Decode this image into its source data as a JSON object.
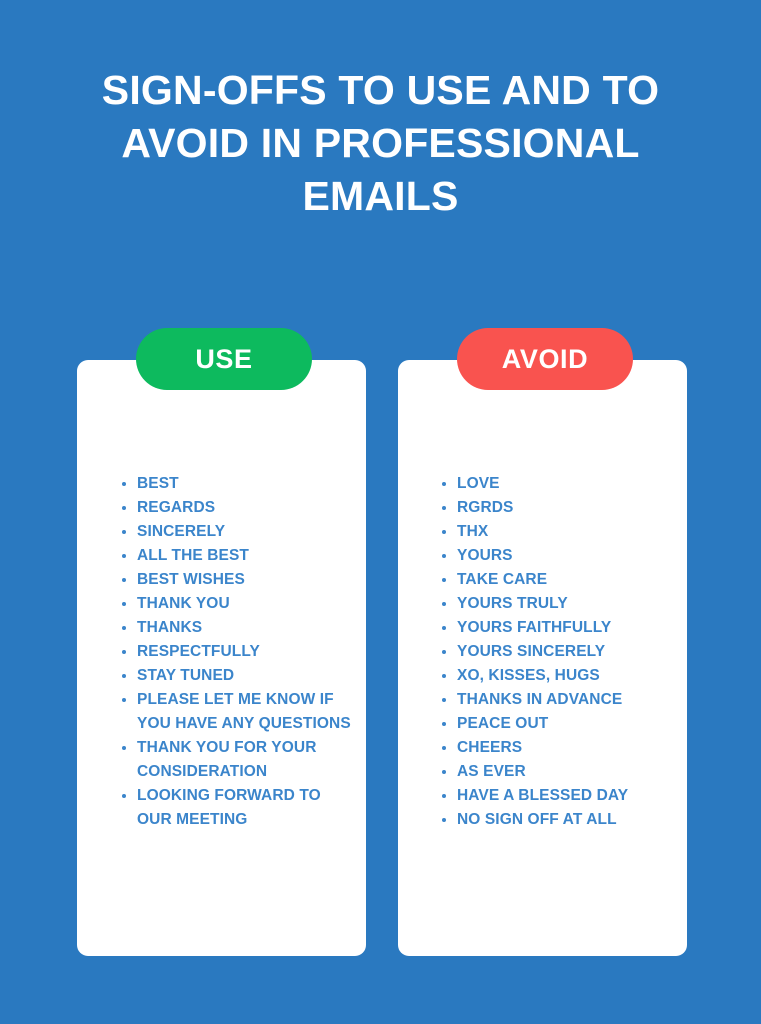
{
  "header": {
    "title": "SIGN-OFFS TO USE AND TO AVOID IN PROFESSIONAL EMAILS"
  },
  "colors": {
    "background": "#2a79c0",
    "card": "#ffffff",
    "use_badge": "#0dba5e",
    "avoid_badge": "#f9534f",
    "list_text": "#3b85cb",
    "title_text": "#ffffff"
  },
  "columns": [
    {
      "id": "use",
      "badge_label": "USE",
      "items": [
        "BEST",
        "REGARDS",
        "SINCERELY",
        "ALL THE BEST",
        "BEST WISHES",
        "THANK YOU",
        "THANKS",
        "RESPECTFULLY",
        "STAY TUNED",
        "PLEASE LET ME KNOW IF YOU HAVE ANY QUESTIONS",
        "THANK YOU FOR YOUR CONSIDERATION",
        "LOOKING FORWARD TO OUR MEETING"
      ]
    },
    {
      "id": "avoid",
      "badge_label": "AVOID",
      "items": [
        "LOVE",
        "RGRDS",
        "THX",
        "YOURS",
        "TAKE CARE",
        "YOURS TRULY",
        "YOURS FAITHFULLY",
        "YOURS SINCERELY",
        "XO, KISSES, HUGS",
        "THANKS IN ADVANCE",
        "PEACE OUT",
        "CHEERS",
        "AS EVER",
        "HAVE A BLESSED DAY",
        "NO SIGN OFF AT ALL"
      ]
    }
  ]
}
